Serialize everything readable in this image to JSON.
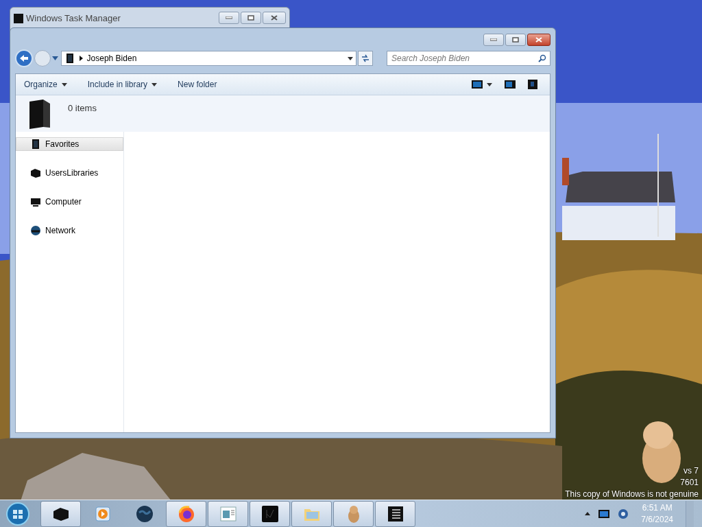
{
  "background_window": {
    "title": "Windows Task Manager"
  },
  "explorer": {
    "address": {
      "crumb": "Joseph Biden"
    },
    "search": {
      "placeholder": "Search Joseph Biden"
    },
    "toolbar": [
      "Organize",
      "Include in library",
      "New folder"
    ],
    "toolbar_menus": [
      true,
      true,
      false
    ],
    "details": {
      "count": "0 items"
    },
    "nav_items": [
      {
        "label": "Favorites",
        "selected": true,
        "kind": "favorites"
      },
      {
        "label": "UsersLibraries",
        "selected": false,
        "kind": "libraries"
      },
      {
        "label": "Computer",
        "selected": false,
        "kind": "computer"
      },
      {
        "label": "Network",
        "selected": false,
        "kind": "network"
      }
    ]
  },
  "desktop_notice": {
    "lines": [
      "vs 7",
      "7601",
      "This copy of Windows is not genuine"
    ]
  },
  "taskbar": {
    "apps": [
      {
        "kind": "explorer",
        "running": true
      },
      {
        "kind": "media",
        "running": false
      },
      {
        "kind": "globe",
        "running": false
      },
      {
        "kind": "firefox",
        "running": true
      },
      {
        "kind": "document",
        "running": true
      },
      {
        "kind": "monitor",
        "running": true
      },
      {
        "kind": "folder",
        "running": true
      },
      {
        "kind": "pet",
        "running": true
      },
      {
        "kind": "list",
        "running": true
      }
    ],
    "clock": {
      "time": "6:51 AM",
      "date": "7/6/2024"
    }
  }
}
